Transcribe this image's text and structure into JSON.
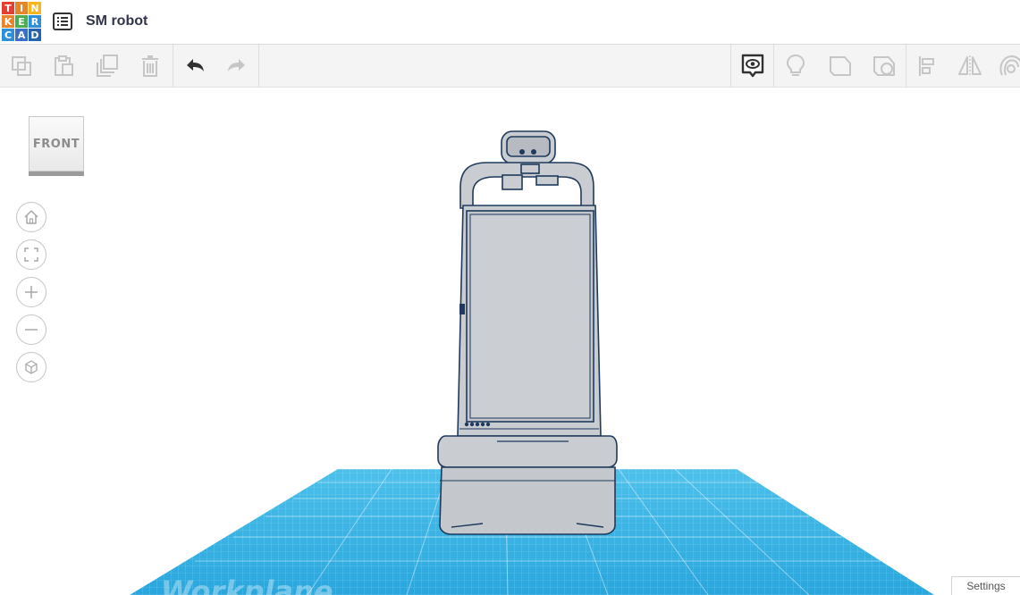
{
  "app": {
    "logo_letters": [
      "T",
      "I",
      "N",
      "K",
      "E",
      "R",
      "C",
      "A",
      "D"
    ],
    "logo_colors": [
      "#e53f30",
      "#e8852a",
      "#f7b51f",
      "#e8852a",
      "#4caf4f",
      "#2f8fd8",
      "#2f8fd8",
      "#3a6fc8",
      "#2563b0"
    ],
    "design_title": "SM robot"
  },
  "toolbar": {
    "items": [
      {
        "icon": "copy-icon",
        "enabled": false
      },
      {
        "icon": "paste-icon",
        "enabled": false
      },
      {
        "icon": "duplicate-icon",
        "enabled": false
      },
      {
        "icon": "delete-icon",
        "enabled": false
      },
      {
        "icon": "undo-icon",
        "enabled": true
      },
      {
        "icon": "redo-icon",
        "enabled": false
      },
      {
        "icon": "notes-eye-icon",
        "enabled": true
      },
      {
        "icon": "lightbulb-icon",
        "enabled": false
      },
      {
        "icon": "solid-shape-icon",
        "enabled": false
      },
      {
        "icon": "hole-shape-icon",
        "enabled": false
      },
      {
        "icon": "align-icon",
        "enabled": false
      },
      {
        "icon": "mirror-icon",
        "enabled": false
      },
      {
        "icon": "group-icon",
        "enabled": false
      }
    ]
  },
  "viewcube": {
    "label": "FRONT"
  },
  "navigation": [
    {
      "icon": "home-icon"
    },
    {
      "icon": "fit-view-icon"
    },
    {
      "icon": "zoom-in-icon"
    },
    {
      "icon": "zoom-out-icon"
    },
    {
      "icon": "perspective-cube-icon"
    }
  ],
  "workplane": {
    "label": "Workplane",
    "color": "#29a9dd"
  },
  "settings": {
    "label": "Settings"
  },
  "colors": {
    "icon_dark": "#323232",
    "icon_disabled": "#c6c6c6",
    "robot_fill": "#c9ccd1",
    "robot_outline": "#1f3a5c"
  }
}
